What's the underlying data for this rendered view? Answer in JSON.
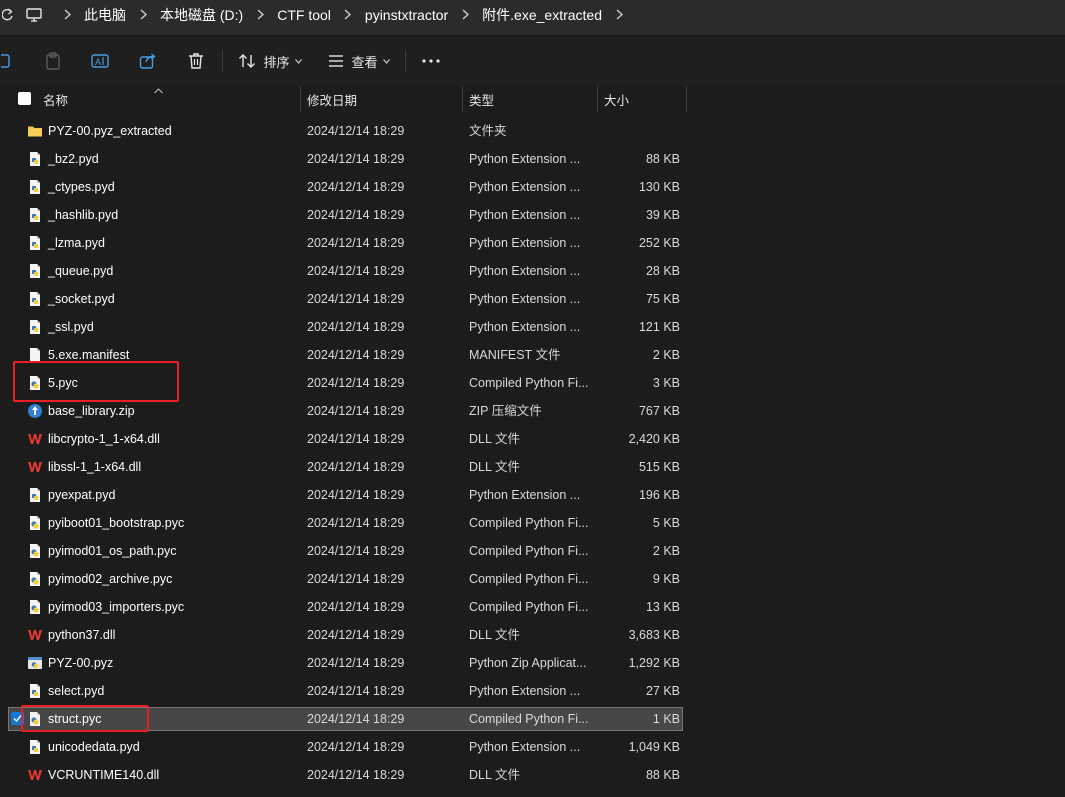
{
  "breadcrumb": {
    "items": [
      "此电脑",
      "本地磁盘 (D:)",
      "CTF tool",
      "pyinstxtractor",
      "附件.exe_extracted"
    ]
  },
  "toolbar": {
    "sort_label": "排序",
    "view_label": "查看"
  },
  "columns": {
    "name": "名称",
    "modified": "修改日期",
    "type": "类型",
    "size": "大小"
  },
  "files": [
    {
      "name": "PYZ-00.pyz_extracted",
      "date": "2024/12/14 18:29",
      "type": "文件夹",
      "size": "",
      "icon": "folder-icon"
    },
    {
      "name": "_bz2.pyd",
      "date": "2024/12/14 18:29",
      "type": "Python Extension ...",
      "size": "88 KB",
      "icon": "pyd-file-icon"
    },
    {
      "name": "_ctypes.pyd",
      "date": "2024/12/14 18:29",
      "type": "Python Extension ...",
      "size": "130 KB",
      "icon": "pyd-file-icon"
    },
    {
      "name": "_hashlib.pyd",
      "date": "2024/12/14 18:29",
      "type": "Python Extension ...",
      "size": "39 KB",
      "icon": "pyd-file-icon"
    },
    {
      "name": "_lzma.pyd",
      "date": "2024/12/14 18:29",
      "type": "Python Extension ...",
      "size": "252 KB",
      "icon": "pyd-file-icon"
    },
    {
      "name": "_queue.pyd",
      "date": "2024/12/14 18:29",
      "type": "Python Extension ...",
      "size": "28 KB",
      "icon": "pyd-file-icon"
    },
    {
      "name": "_socket.pyd",
      "date": "2024/12/14 18:29",
      "type": "Python Extension ...",
      "size": "75 KB",
      "icon": "pyd-file-icon"
    },
    {
      "name": "_ssl.pyd",
      "date": "2024/12/14 18:29",
      "type": "Python Extension ...",
      "size": "121 KB",
      "icon": "pyd-file-icon"
    },
    {
      "name": "5.exe.manifest",
      "date": "2024/12/14 18:29",
      "type": "MANIFEST 文件",
      "size": "2 KB",
      "icon": "blank-file-icon"
    },
    {
      "name": "5.pyc",
      "date": "2024/12/14 18:29",
      "type": "Compiled Python Fi...",
      "size": "3 KB",
      "icon": "pyc-file-icon"
    },
    {
      "name": "base_library.zip",
      "date": "2024/12/14 18:29",
      "type": "ZIP 压缩文件",
      "size": "767 KB",
      "icon": "zip-file-icon"
    },
    {
      "name": "libcrypto-1_1-x64.dll",
      "date": "2024/12/14 18:29",
      "type": "DLL 文件",
      "size": "2,420 KB",
      "icon": "dll-file-icon"
    },
    {
      "name": "libssl-1_1-x64.dll",
      "date": "2024/12/14 18:29",
      "type": "DLL 文件",
      "size": "515 KB",
      "icon": "dll-file-icon"
    },
    {
      "name": "pyexpat.pyd",
      "date": "2024/12/14 18:29",
      "type": "Python Extension ...",
      "size": "196 KB",
      "icon": "pyd-file-icon"
    },
    {
      "name": "pyiboot01_bootstrap.pyc",
      "date": "2024/12/14 18:29",
      "type": "Compiled Python Fi...",
      "size": "5 KB",
      "icon": "pyc-file-icon"
    },
    {
      "name": "pyimod01_os_path.pyc",
      "date": "2024/12/14 18:29",
      "type": "Compiled Python Fi...",
      "size": "2 KB",
      "icon": "pyc-file-icon"
    },
    {
      "name": "pyimod02_archive.pyc",
      "date": "2024/12/14 18:29",
      "type": "Compiled Python Fi...",
      "size": "9 KB",
      "icon": "pyc-file-icon"
    },
    {
      "name": "pyimod03_importers.pyc",
      "date": "2024/12/14 18:29",
      "type": "Compiled Python Fi...",
      "size": "13 KB",
      "icon": "pyc-file-icon"
    },
    {
      "name": "python37.dll",
      "date": "2024/12/14 18:29",
      "type": "DLL 文件",
      "size": "3,683 KB",
      "icon": "dll-file-icon"
    },
    {
      "name": "PYZ-00.pyz",
      "date": "2024/12/14 18:29",
      "type": "Python Zip Applicat...",
      "size": "1,292 KB",
      "icon": "pyz-file-icon"
    },
    {
      "name": "select.pyd",
      "date": "2024/12/14 18:29",
      "type": "Python Extension ...",
      "size": "27 KB",
      "icon": "pyd-file-icon"
    },
    {
      "name": "struct.pyc",
      "date": "2024/12/14 18:29",
      "type": "Compiled Python Fi...",
      "size": "1 KB",
      "icon": "pyc-file-icon",
      "selected": true
    },
    {
      "name": "unicodedata.pyd",
      "date": "2024/12/14 18:29",
      "type": "Python Extension ...",
      "size": "1,049 KB",
      "icon": "pyd-file-icon"
    },
    {
      "name": "VCRUNTIME140.dll",
      "date": "2024/12/14 18:29",
      "type": "DLL 文件",
      "size": "88 KB",
      "icon": "dll-file-icon"
    }
  ],
  "colors": {
    "background": "#1c1c1c",
    "selection": "#474747",
    "annotation": "#e81f24",
    "checkbox": "#0f7ad6"
  }
}
